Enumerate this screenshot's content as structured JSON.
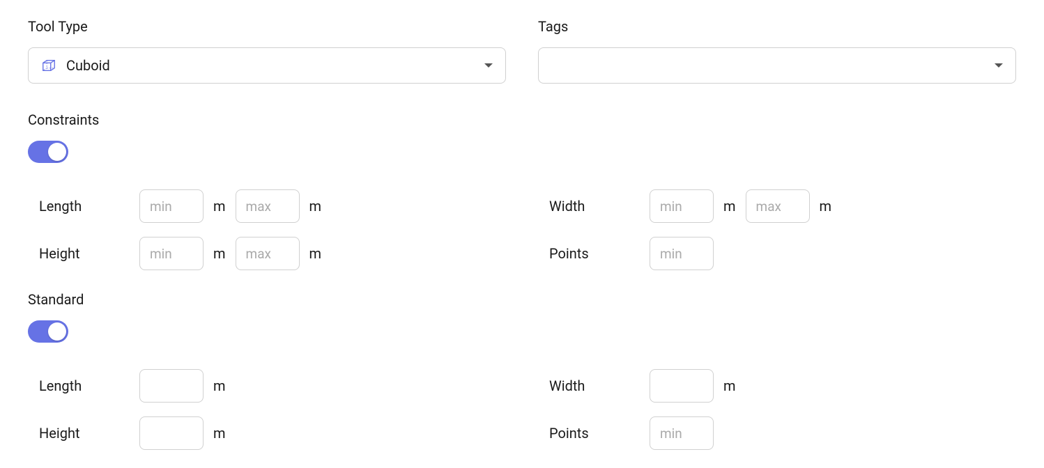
{
  "toolType": {
    "label": "Tool Type",
    "value": "Cuboid"
  },
  "tags": {
    "label": "Tags",
    "value": ""
  },
  "constraints": {
    "label": "Constraints",
    "enabled": true,
    "length": {
      "label": "Length",
      "min": "",
      "max": "",
      "unit": "m",
      "minPlaceholder": "min",
      "maxPlaceholder": "max"
    },
    "width": {
      "label": "Width",
      "min": "",
      "max": "",
      "unit": "m",
      "minPlaceholder": "min",
      "maxPlaceholder": "max"
    },
    "height": {
      "label": "Height",
      "min": "",
      "max": "",
      "unit": "m",
      "minPlaceholder": "min",
      "maxPlaceholder": "max"
    },
    "points": {
      "label": "Points",
      "min": "",
      "minPlaceholder": "min"
    }
  },
  "standard": {
    "label": "Standard",
    "enabled": true,
    "length": {
      "label": "Length",
      "value": "",
      "unit": "m"
    },
    "width": {
      "label": "Width",
      "value": "",
      "unit": "m"
    },
    "height": {
      "label": "Height",
      "value": "",
      "unit": "m"
    },
    "points": {
      "label": "Points",
      "min": "",
      "minPlaceholder": "min"
    }
  }
}
